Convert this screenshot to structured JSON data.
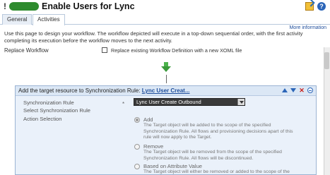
{
  "window": {
    "title_prefix": "!",
    "title": "Enable Users for Lync"
  },
  "tabs": [
    {
      "label": "General"
    },
    {
      "label": "Activities"
    }
  ],
  "more_info": "More information",
  "intro": "Use this page to design your workflow. The workflow depicted will execute in a top-down sequential order, with the first activity completing its execution before the workflow moves to the next activity.",
  "replace": {
    "label": "Replace Workflow",
    "checkbox_label": "Replace existing Workflow Definition with a new XOML file",
    "checked": false
  },
  "activity": {
    "title": "Add the target resource to Synchronization Rule:",
    "link": "Lync User Creat...",
    "sync_rule_label": "Synchronization Rule",
    "sync_rule_sub": "Select Synchronization Rule",
    "required_mark": "*",
    "sync_rule_value": "Lync User Create Outbound",
    "action_label": "Action Selection",
    "options": [
      {
        "title": "Add",
        "desc": "The Target object will be added to the scope of the specified Synchronization Rule. All flows and provisioning decisions apart of this rule will now apply to the Target.",
        "selected": true
      },
      {
        "title": "Remove",
        "desc": "The Target object will be removed from the scope of the specified Synchronization Rule. All flows will be discontinued.",
        "selected": false
      },
      {
        "title": "Based on Attribute Value",
        "desc": "The Target object will either be removed or added to the scope of the",
        "selected": false
      }
    ]
  },
  "colors": {
    "accent_green": "#3a9a3a",
    "link_blue": "#1f4e9c",
    "delete_red": "#c8201c"
  }
}
